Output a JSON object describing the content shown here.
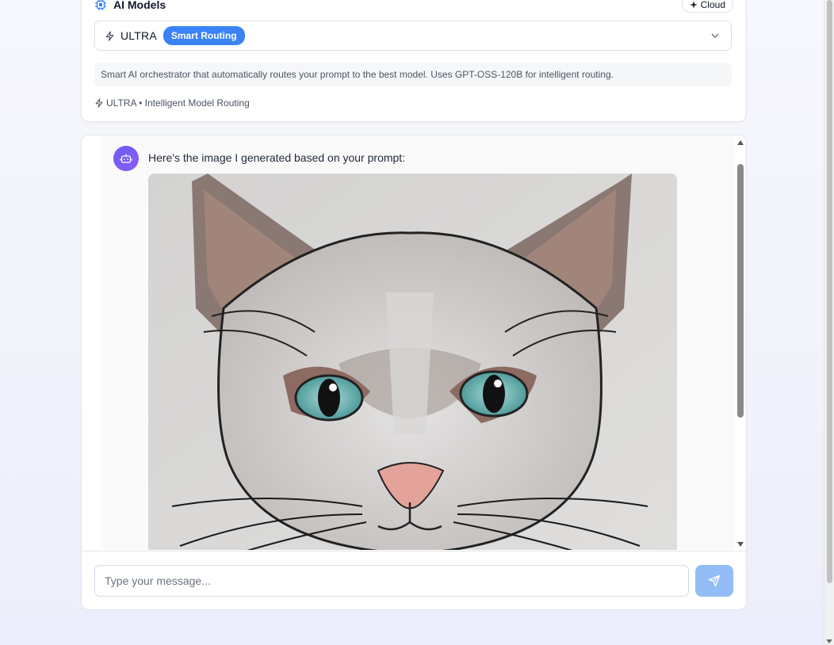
{
  "model_panel": {
    "title": "AI Models",
    "cloud_label": "Cloud",
    "selected_model": "ULTRA",
    "selected_badge": "Smart Routing",
    "description": "Smart AI orchestrator that automatically routes your prompt to the best model. Uses GPT-OSS-120B for intelligent routing.",
    "meta": "ULTRA • Intelligent Model Routing"
  },
  "chat": {
    "assistant_message": "Here's the image I generated based on your prompt:",
    "generated_image_subject": "cat portrait illustration",
    "input_placeholder": "Type your message...",
    "send_icon": "send-icon"
  },
  "colors": {
    "accent": "#3b82f6",
    "send_button": "#93bdf6",
    "avatar": "#7c5cf6"
  }
}
